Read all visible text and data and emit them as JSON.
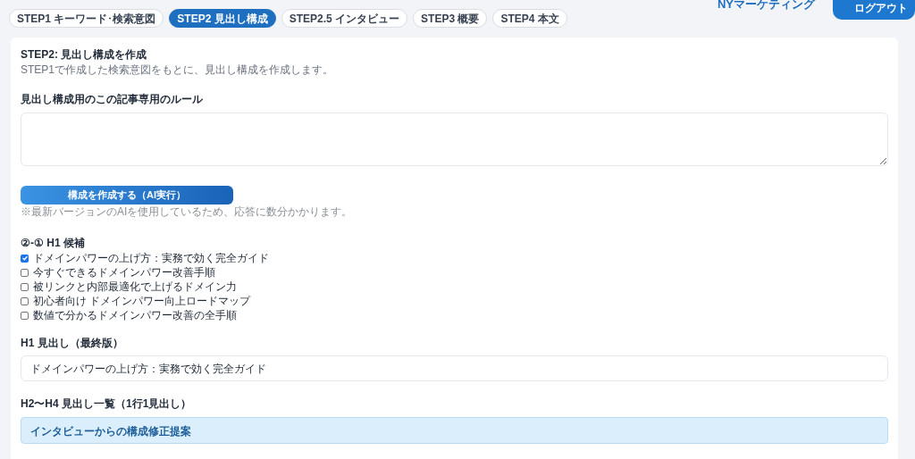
{
  "header": {
    "brand": "NYマーケティング",
    "logout_button": "ログアウト"
  },
  "tabs": [
    {
      "label": "STEP1 キーワード･検索意図",
      "selected": false
    },
    {
      "label": "STEP2 見出し構成",
      "selected": true
    },
    {
      "label": "STEP2.5 インタビュー",
      "selected": false
    },
    {
      "label": "STEP3 概要",
      "selected": false
    },
    {
      "label": "STEP4 本文",
      "selected": false
    }
  ],
  "panel": {
    "title": "STEP2: 見出し構成を作成",
    "description": "STEP1で作成した検索意図をもとに、見出し構成を作成します。",
    "rules_label": "見出し構成用のこの記事専用のルール",
    "run_button": "構成を作成する（AI実行）",
    "run_note": "※最新バージョンのAIを使用しているため、応答に数分かかります。",
    "h1_candidates_title": "②-① H1 候補",
    "h1_candidates": [
      {
        "label": "ドメインパワーの上げ方：実務で効く完全ガイド",
        "checked": true
      },
      {
        "label": "今すぐできるドメインパワー改善手順",
        "checked": false
      },
      {
        "label": "被リンクと内部最適化で上げるドメイン力",
        "checked": false
      },
      {
        "label": "初心者向け ドメインパワー向上ロードマップ",
        "checked": false
      },
      {
        "label": "数値で分かるドメインパワー改善の全手順",
        "checked": false
      }
    ],
    "h1_final_label": "H1 見出し（最終版）",
    "h1_final_value": "ドメインパワーの上げ方：実務で効く完全ガイド",
    "h2_h4_label": "H2〜H4 見出し一覧（1行1見出し）",
    "interview_box": "インタビューからの構成修正提案"
  }
}
